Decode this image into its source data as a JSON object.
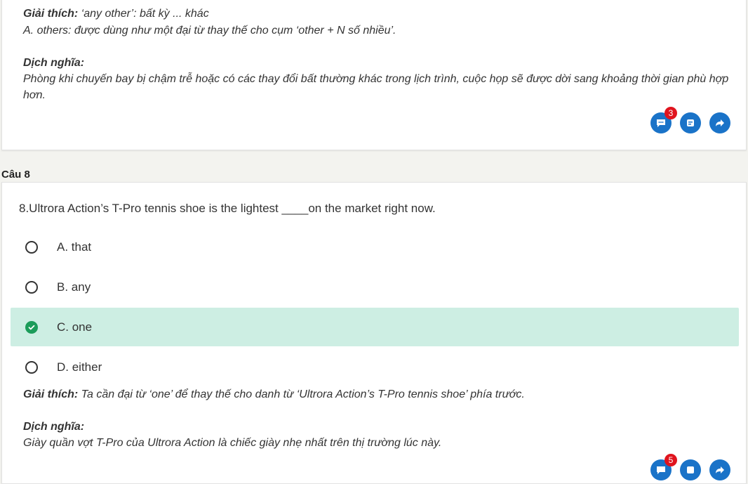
{
  "prev": {
    "explanation_label": "Giải thích:",
    "explanation_text": " ‘any other’: bất kỳ ... khác",
    "option_note": "A. others: được dùng như một đại từ thay thế cho cụm ‘other + N số nhiều’.",
    "translation_label": "Dịch nghĩa:",
    "translation_text": "Phòng khi chuyến bay bị chậm trễ hoặc có các thay đổi bất thường khác trong lịch trình, cuộc họp sẽ được dời sang khoảng thời gian phù hợp hơn.",
    "comment_count": "3"
  },
  "section": {
    "label": "Câu 8"
  },
  "question": {
    "text": "8.Ultrora Action’s T-Pro tennis shoe is the lightest ____on the market right now.",
    "options": [
      {
        "label": "A. that",
        "correct": false
      },
      {
        "label": "B. any",
        "correct": false
      },
      {
        "label": "C. one",
        "correct": true
      },
      {
        "label": "D. either",
        "correct": false
      }
    ],
    "explanation_label": "Giải thích:",
    "explanation_text": " Ta cần đại từ ‘one’ để thay thế cho danh từ ‘Ultrora Action’s T-Pro tennis shoe’ phía trước.",
    "translation_label": "Dịch nghĩa:",
    "translation_text": "Giày quần vợt T-Pro của Ultrora Action là chiếc giày nhẹ nhất trên thị trường lúc này.",
    "comment_count": "5"
  },
  "colors": {
    "accent": "#1a73c8",
    "badge": "#e0141e",
    "correct_bg": "#cdeee3",
    "correct_check": "#1c9c5a"
  }
}
